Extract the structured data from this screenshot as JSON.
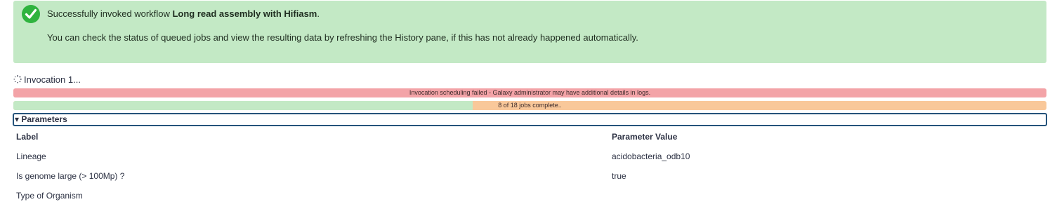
{
  "success": {
    "prefix": "Successfully invoked workflow ",
    "workflow_name": "Long read assembly with Hifiasm",
    "suffix": ".",
    "message": "You can check the status of queued jobs and view the resulting data by refreshing the History pane, if this has not already happened automatically.",
    "icon": "check-circle-icon",
    "color": "#c3e9c5"
  },
  "invocation": {
    "label": "Invocation 1...",
    "icon": "spinner-icon"
  },
  "scheduling": {
    "text": "Invocation scheduling failed - Galaxy administrator may have additional details in logs.",
    "color": "#f3a3a7"
  },
  "jobs": {
    "text": "8 of 18 jobs complete..",
    "complete": 8,
    "total": 18,
    "complete_color": "#c3e9c5",
    "pending_color": "#f9c89a"
  },
  "parameters": {
    "toggle": "▾ Parameters",
    "columns": [
      "Label",
      "Parameter Value"
    ],
    "rows": [
      {
        "label": "Lineage",
        "value": "acidobacteria_odb10"
      },
      {
        "label": "Is genome large (> 100Mp) ?",
        "value": "true"
      },
      {
        "label": "Type of Organism",
        "value": ""
      }
    ]
  }
}
